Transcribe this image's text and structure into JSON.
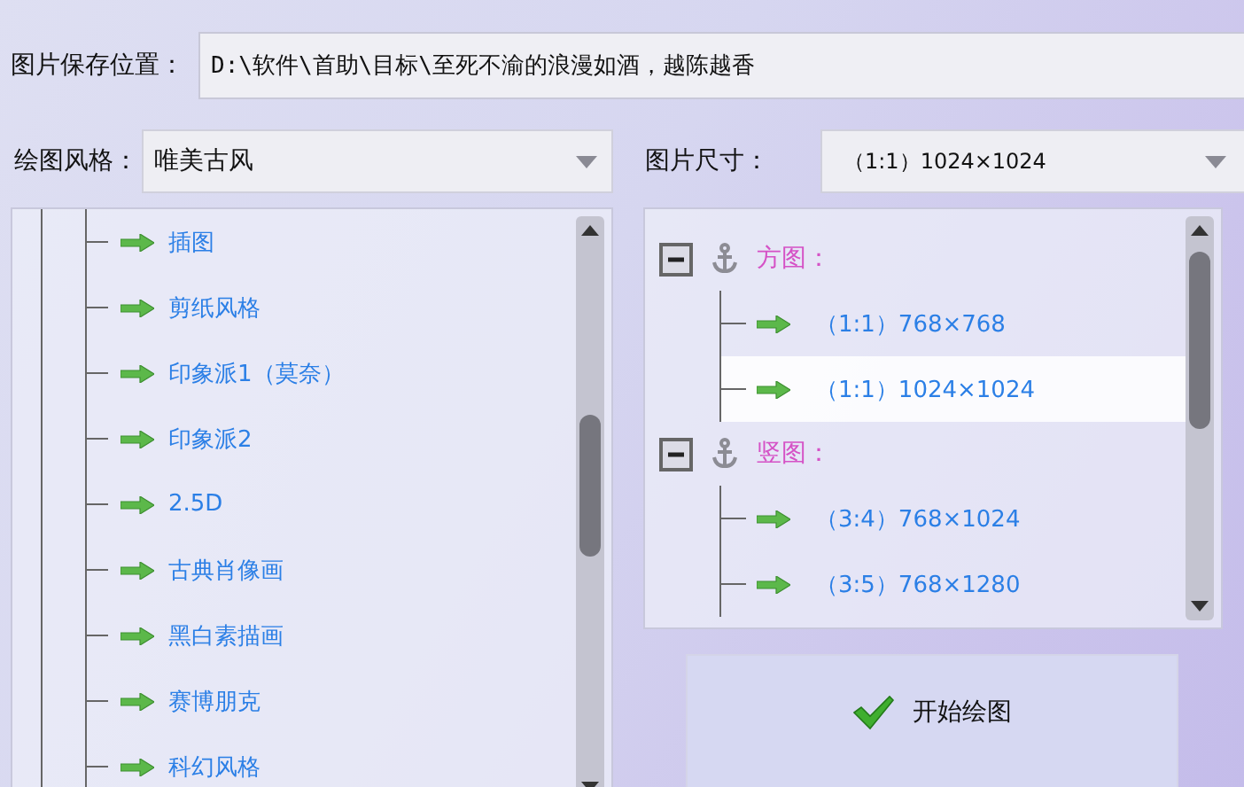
{
  "save_path": {
    "label": "图片保存位置：",
    "value": "D:\\软件\\首助\\目标\\至死不渝的浪漫如酒，越陈越香"
  },
  "style": {
    "label": "绘图风格：",
    "value": "唯美古风"
  },
  "size": {
    "label": "图片尺寸：",
    "value": "（1:1）1024×1024"
  },
  "style_tree": [
    {
      "label": "插图",
      "selected": false
    },
    {
      "label": "剪纸风格",
      "selected": false
    },
    {
      "label": "印象派1（莫奈）",
      "selected": false
    },
    {
      "label": "印象派2",
      "selected": false
    },
    {
      "label": "2.5D",
      "selected": false
    },
    {
      "label": "古典肖像画",
      "selected": false
    },
    {
      "label": "黑白素描画",
      "selected": false
    },
    {
      "label": "赛博朋克",
      "selected": false
    },
    {
      "label": "科幻风格",
      "selected": false
    }
  ],
  "size_tree": [
    {
      "label": "方图：",
      "expanded": true,
      "children": [
        {
          "label": "（1:1）768×768",
          "selected": false
        },
        {
          "label": "（1:1）1024×1024",
          "selected": true
        }
      ]
    },
    {
      "label": "竖图：",
      "expanded": true,
      "children": [
        {
          "label": "（3:4）768×1024",
          "selected": false
        },
        {
          "label": "（3:5）768×1280",
          "selected": false
        }
      ]
    }
  ],
  "start_button": {
    "label": "开始绘图"
  }
}
